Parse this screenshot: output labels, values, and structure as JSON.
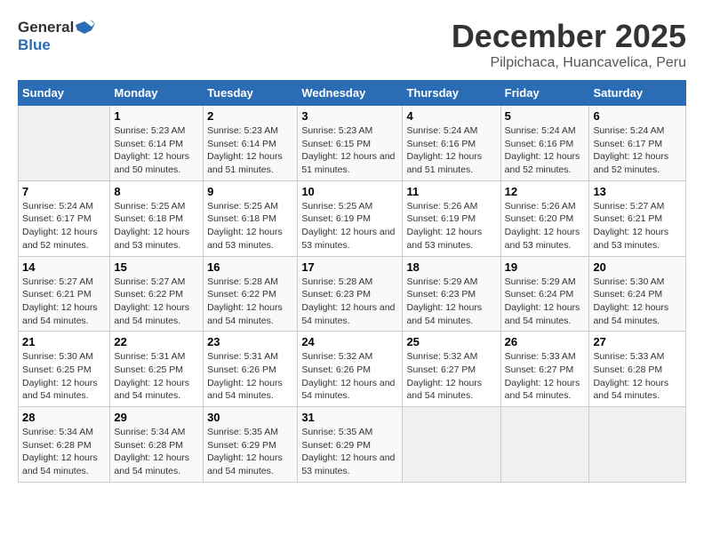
{
  "header": {
    "logo_general": "General",
    "logo_blue": "Blue",
    "title": "December 2025",
    "subtitle": "Pilpichaca, Huancavelica, Peru"
  },
  "calendar": {
    "days": [
      "Sunday",
      "Monday",
      "Tuesday",
      "Wednesday",
      "Thursday",
      "Friday",
      "Saturday"
    ],
    "weeks": [
      [
        {
          "date": "",
          "info": ""
        },
        {
          "date": "1",
          "sunrise": "Sunrise: 5:23 AM",
          "sunset": "Sunset: 6:14 PM",
          "daylight": "Daylight: 12 hours and 50 minutes."
        },
        {
          "date": "2",
          "sunrise": "Sunrise: 5:23 AM",
          "sunset": "Sunset: 6:14 PM",
          "daylight": "Daylight: 12 hours and 51 minutes."
        },
        {
          "date": "3",
          "sunrise": "Sunrise: 5:23 AM",
          "sunset": "Sunset: 6:15 PM",
          "daylight": "Daylight: 12 hours and 51 minutes."
        },
        {
          "date": "4",
          "sunrise": "Sunrise: 5:24 AM",
          "sunset": "Sunset: 6:16 PM",
          "daylight": "Daylight: 12 hours and 51 minutes."
        },
        {
          "date": "5",
          "sunrise": "Sunrise: 5:24 AM",
          "sunset": "Sunset: 6:16 PM",
          "daylight": "Daylight: 12 hours and 52 minutes."
        },
        {
          "date": "6",
          "sunrise": "Sunrise: 5:24 AM",
          "sunset": "Sunset: 6:17 PM",
          "daylight": "Daylight: 12 hours and 52 minutes."
        }
      ],
      [
        {
          "date": "7",
          "sunrise": "Sunrise: 5:24 AM",
          "sunset": "Sunset: 6:17 PM",
          "daylight": "Daylight: 12 hours and 52 minutes."
        },
        {
          "date": "8",
          "sunrise": "Sunrise: 5:25 AM",
          "sunset": "Sunset: 6:18 PM",
          "daylight": "Daylight: 12 hours and 53 minutes."
        },
        {
          "date": "9",
          "sunrise": "Sunrise: 5:25 AM",
          "sunset": "Sunset: 6:18 PM",
          "daylight": "Daylight: 12 hours and 53 minutes."
        },
        {
          "date": "10",
          "sunrise": "Sunrise: 5:25 AM",
          "sunset": "Sunset: 6:19 PM",
          "daylight": "Daylight: 12 hours and 53 minutes."
        },
        {
          "date": "11",
          "sunrise": "Sunrise: 5:26 AM",
          "sunset": "Sunset: 6:19 PM",
          "daylight": "Daylight: 12 hours and 53 minutes."
        },
        {
          "date": "12",
          "sunrise": "Sunrise: 5:26 AM",
          "sunset": "Sunset: 6:20 PM",
          "daylight": "Daylight: 12 hours and 53 minutes."
        },
        {
          "date": "13",
          "sunrise": "Sunrise: 5:27 AM",
          "sunset": "Sunset: 6:21 PM",
          "daylight": "Daylight: 12 hours and 53 minutes."
        }
      ],
      [
        {
          "date": "14",
          "sunrise": "Sunrise: 5:27 AM",
          "sunset": "Sunset: 6:21 PM",
          "daylight": "Daylight: 12 hours and 54 minutes."
        },
        {
          "date": "15",
          "sunrise": "Sunrise: 5:27 AM",
          "sunset": "Sunset: 6:22 PM",
          "daylight": "Daylight: 12 hours and 54 minutes."
        },
        {
          "date": "16",
          "sunrise": "Sunrise: 5:28 AM",
          "sunset": "Sunset: 6:22 PM",
          "daylight": "Daylight: 12 hours and 54 minutes."
        },
        {
          "date": "17",
          "sunrise": "Sunrise: 5:28 AM",
          "sunset": "Sunset: 6:23 PM",
          "daylight": "Daylight: 12 hours and 54 minutes."
        },
        {
          "date": "18",
          "sunrise": "Sunrise: 5:29 AM",
          "sunset": "Sunset: 6:23 PM",
          "daylight": "Daylight: 12 hours and 54 minutes."
        },
        {
          "date": "19",
          "sunrise": "Sunrise: 5:29 AM",
          "sunset": "Sunset: 6:24 PM",
          "daylight": "Daylight: 12 hours and 54 minutes."
        },
        {
          "date": "20",
          "sunrise": "Sunrise: 5:30 AM",
          "sunset": "Sunset: 6:24 PM",
          "daylight": "Daylight: 12 hours and 54 minutes."
        }
      ],
      [
        {
          "date": "21",
          "sunrise": "Sunrise: 5:30 AM",
          "sunset": "Sunset: 6:25 PM",
          "daylight": "Daylight: 12 hours and 54 minutes."
        },
        {
          "date": "22",
          "sunrise": "Sunrise: 5:31 AM",
          "sunset": "Sunset: 6:25 PM",
          "daylight": "Daylight: 12 hours and 54 minutes."
        },
        {
          "date": "23",
          "sunrise": "Sunrise: 5:31 AM",
          "sunset": "Sunset: 6:26 PM",
          "daylight": "Daylight: 12 hours and 54 minutes."
        },
        {
          "date": "24",
          "sunrise": "Sunrise: 5:32 AM",
          "sunset": "Sunset: 6:26 PM",
          "daylight": "Daylight: 12 hours and 54 minutes."
        },
        {
          "date": "25",
          "sunrise": "Sunrise: 5:32 AM",
          "sunset": "Sunset: 6:27 PM",
          "daylight": "Daylight: 12 hours and 54 minutes."
        },
        {
          "date": "26",
          "sunrise": "Sunrise: 5:33 AM",
          "sunset": "Sunset: 6:27 PM",
          "daylight": "Daylight: 12 hours and 54 minutes."
        },
        {
          "date": "27",
          "sunrise": "Sunrise: 5:33 AM",
          "sunset": "Sunset: 6:28 PM",
          "daylight": "Daylight: 12 hours and 54 minutes."
        }
      ],
      [
        {
          "date": "28",
          "sunrise": "Sunrise: 5:34 AM",
          "sunset": "Sunset: 6:28 PM",
          "daylight": "Daylight: 12 hours and 54 minutes."
        },
        {
          "date": "29",
          "sunrise": "Sunrise: 5:34 AM",
          "sunset": "Sunset: 6:28 PM",
          "daylight": "Daylight: 12 hours and 54 minutes."
        },
        {
          "date": "30",
          "sunrise": "Sunrise: 5:35 AM",
          "sunset": "Sunset: 6:29 PM",
          "daylight": "Daylight: 12 hours and 54 minutes."
        },
        {
          "date": "31",
          "sunrise": "Sunrise: 5:35 AM",
          "sunset": "Sunset: 6:29 PM",
          "daylight": "Daylight: 12 hours and 53 minutes."
        },
        {
          "date": "",
          "info": ""
        },
        {
          "date": "",
          "info": ""
        },
        {
          "date": "",
          "info": ""
        }
      ]
    ]
  }
}
